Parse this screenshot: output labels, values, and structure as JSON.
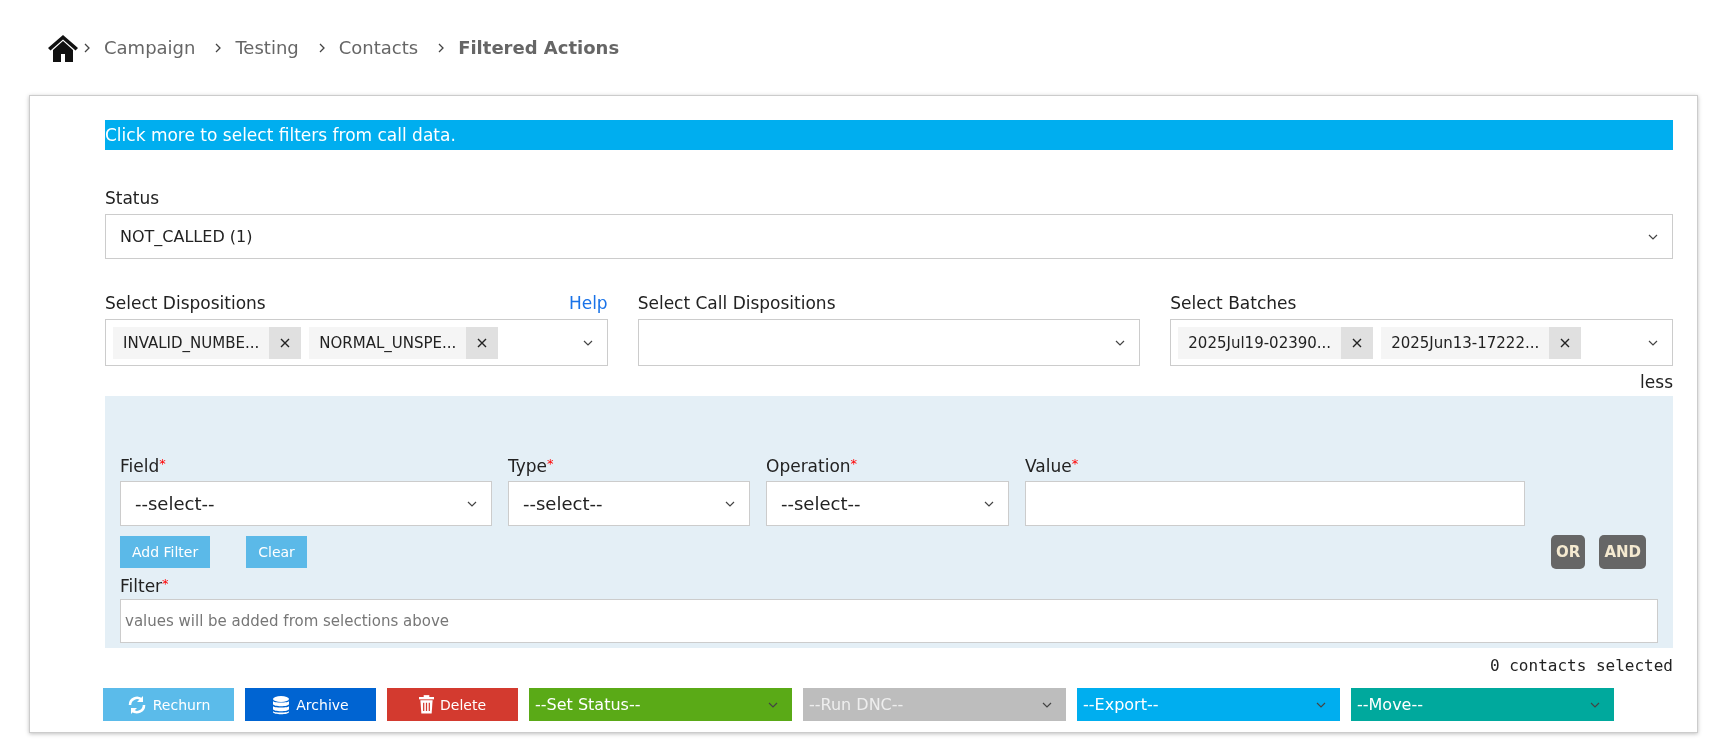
{
  "breadcrumb": [
    {
      "label": "Campaign",
      "current": false
    },
    {
      "label": "Testing",
      "current": false
    },
    {
      "label": "Contacts",
      "current": false
    },
    {
      "label": "Filtered Actions",
      "current": true
    }
  ],
  "banner": "Click more to select filters from call data.",
  "status": {
    "label": "Status",
    "value": "NOT_CALLED (1)"
  },
  "multiselects": [
    {
      "label": "Select Dispositions",
      "help": "Help",
      "tags": [
        "INVALID_NUMBE...",
        "NORMAL_UNSPE..."
      ]
    },
    {
      "label": "Select Call Dispositions"
    },
    {
      "label": "Select Batches",
      "tags": [
        "2025Jul19-02390...",
        "2025Jun13-17222..."
      ]
    }
  ],
  "toggle_link": "less",
  "filter_builder": {
    "fields": [
      {
        "label": "Field",
        "kind": "select",
        "value": "--select--"
      },
      {
        "label": "Type",
        "kind": "select",
        "value": "--select--"
      },
      {
        "label": "Operation",
        "kind": "select",
        "value": "--select--"
      },
      {
        "label": "Value",
        "kind": "input"
      }
    ],
    "required_mark": "*",
    "buttons": [
      "Add Filter",
      "Clear"
    ],
    "logic_buttons": [
      "OR",
      "AND"
    ],
    "filter_label": "Filter",
    "filter_placeholder": "values will be added from selections above"
  },
  "selection_count": "0 contacts selected",
  "actions": [
    {
      "label": "Rechurn",
      "kind": "button",
      "color": "#5bbbea"
    },
    {
      "label": "Archive",
      "kind": "button",
      "color": "#0064d2"
    },
    {
      "label": "Delete",
      "kind": "button",
      "color": "#d33a2f"
    },
    {
      "label": "--Set Status--",
      "kind": "dropdown",
      "color": "#5aaa17",
      "disabled": false
    },
    {
      "label": "--Run DNC--",
      "kind": "dropdown",
      "color": "#bdbdbd",
      "disabled": true
    },
    {
      "label": "--Export--",
      "kind": "dropdown",
      "color": "#00aeef",
      "disabled": false
    },
    {
      "label": "--Move--",
      "kind": "dropdown",
      "color": "#00a99d",
      "disabled": false
    }
  ]
}
